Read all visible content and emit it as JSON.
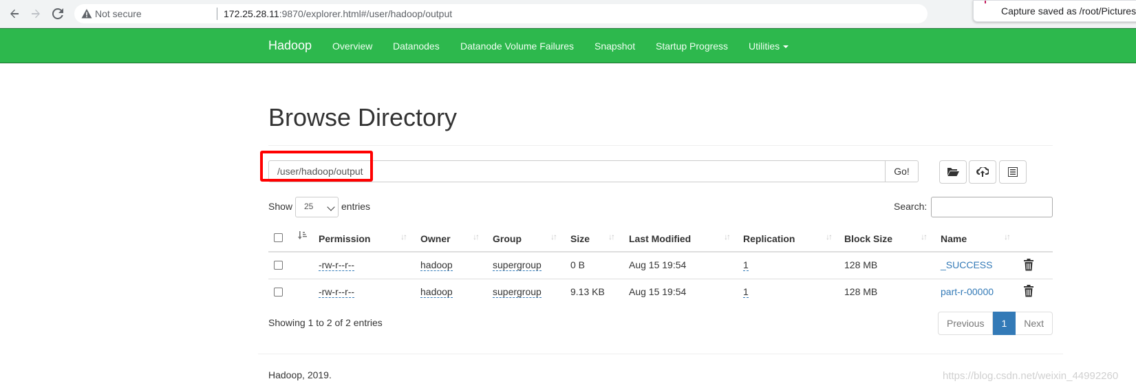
{
  "browser": {
    "not_secure": "Not secure",
    "url_host": "172.25.28.11",
    "url_rest": ":9870/explorer.html#/user/hadoop/output",
    "toast": "Capture saved as /root/Pictures"
  },
  "navbar": {
    "brand": "Hadoop",
    "items": [
      "Overview",
      "Datanodes",
      "Datanode Volume Failures",
      "Snapshot",
      "Startup Progress",
      "Utilities"
    ]
  },
  "page": {
    "title": "Browse Directory",
    "path_value": "/user/hadoop/output",
    "go_label": "Go!",
    "show_label": "Show",
    "entries_value": "25",
    "entries_label": "entries",
    "search_label": "Search:",
    "showing_text": "Showing 1 to 2 of 2 entries",
    "footer": "Hadoop, 2019.",
    "watermark": "https://blog.csdn.net/weixin_44992260"
  },
  "table": {
    "columns": [
      "Permission",
      "Owner",
      "Group",
      "Size",
      "Last Modified",
      "Replication",
      "Block Size",
      "Name"
    ],
    "rows": [
      {
        "permission": "-rw-r--r--",
        "owner": "hadoop",
        "group": "supergroup",
        "size": "0 B",
        "modified": "Aug 15 19:54",
        "replication": "1",
        "block_size": "128 MB",
        "name": "_SUCCESS"
      },
      {
        "permission": "-rw-r--r--",
        "owner": "hadoop",
        "group": "supergroup",
        "size": "9.13 KB",
        "modified": "Aug 15 19:54",
        "replication": "1",
        "block_size": "128 MB",
        "name": "part-r-00000"
      }
    ]
  },
  "pagination": {
    "previous": "Previous",
    "current": "1",
    "next": "Next"
  },
  "colors": {
    "navbar": "#2db84d",
    "link": "#337ab7",
    "highlight": "#ff0000"
  },
  "icons": [
    "back-arrow-icon",
    "forward-arrow-icon",
    "reload-icon",
    "warning-icon",
    "folder-open-icon",
    "cloud-upload-icon",
    "list-icon",
    "trash-icon",
    "sort-icon"
  ]
}
